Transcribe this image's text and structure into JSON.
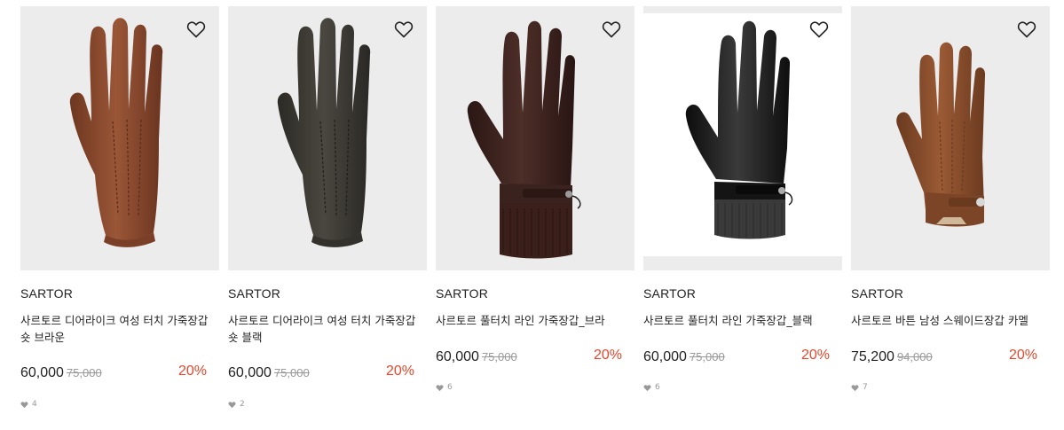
{
  "products": [
    {
      "brand": "SARTOR",
      "name": "사르토르 디어라이크 여성 터치 가죽장갑 숏 브라운",
      "price": "60,000",
      "original_price": "75,000",
      "discount": "20%",
      "likes": "4",
      "color": "#8a4a2e",
      "style": "brown-deer",
      "heart_icon": "heart-outline-icon"
    },
    {
      "brand": "SARTOR",
      "name": "사르토르 디어라이크 여성 터치 가죽장갑 숏 블랙",
      "price": "60,000",
      "original_price": "75,000",
      "discount": "20%",
      "likes": "2",
      "color": "#3c3a34",
      "style": "dark-deer",
      "heart_icon": "heart-outline-icon"
    },
    {
      "brand": "SARTOR",
      "name": "사르토르 풀터치 라인 가죽장갑_브라",
      "price": "60,000",
      "original_price": "75,000",
      "discount": "20%",
      "likes": "6",
      "color": "#3b2420",
      "style": "brown-cuff",
      "heart_icon": "heart-outline-icon"
    },
    {
      "brand": "SARTOR",
      "name": "사르토르 풀터치 라인 가죽장갑_블랙",
      "price": "60,000",
      "original_price": "75,000",
      "discount": "20%",
      "likes": "6",
      "color": "#1c1c1c",
      "style": "black-cuff",
      "heart_icon": "heart-outline-icon"
    },
    {
      "brand": "SARTOR",
      "name": "사르토르 바튼 남성 스웨이드장갑 카멜",
      "price": "75,200",
      "original_price": "94,000",
      "discount": "20%",
      "likes": "7",
      "color": "#8a5030",
      "style": "suede",
      "heart_icon": "heart-outline-icon"
    }
  ],
  "colors": {
    "discount": "#e8462b",
    "image_bg": "#ececec",
    "muted": "#999999"
  }
}
